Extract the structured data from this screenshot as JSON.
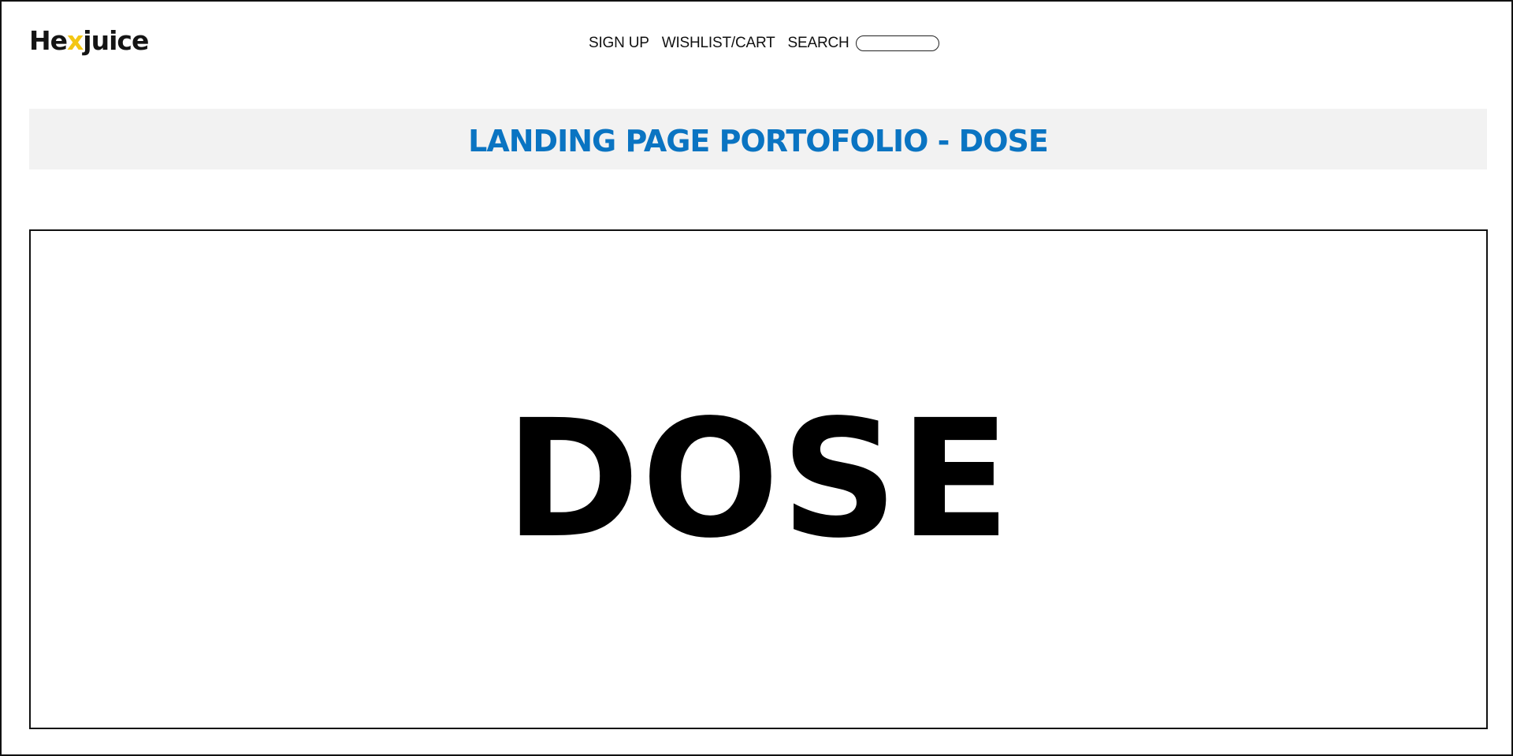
{
  "brand": {
    "logo_prefix": "He",
    "logo_accent": "x",
    "logo_suffix": "juice",
    "accent_color": "#f3c613"
  },
  "nav": {
    "signup_label": "SIGN UP",
    "wishlist_label": "WISHLIST/CART",
    "search_label": "SEARCH",
    "search_value": ""
  },
  "page": {
    "title": "LANDING PAGE PORTOFOLIO - DOSE",
    "title_color": "#0a74c2"
  },
  "hero": {
    "word": "DOSE"
  }
}
